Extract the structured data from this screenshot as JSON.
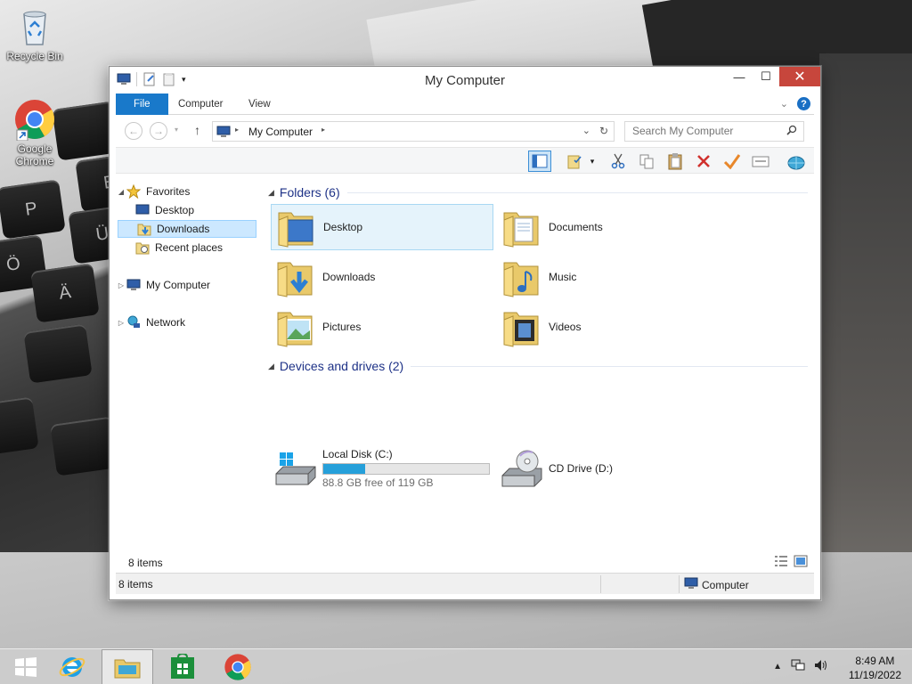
{
  "desktop": {
    "icons": [
      {
        "label": "Recycle Bin"
      },
      {
        "label": "Google Chrome"
      }
    ]
  },
  "window": {
    "title": "My Computer",
    "ribbon_tabs": [
      "File",
      "Computer",
      "View"
    ],
    "address": {
      "path_label": "My Computer"
    },
    "search": {
      "placeholder": "Search My Computer"
    }
  },
  "navpane": {
    "favorites": "Favorites",
    "desktop": "Desktop",
    "downloads": "Downloads",
    "recent": "Recent places",
    "mycomputer": "My Computer",
    "network": "Network"
  },
  "content": {
    "folders_header": "Folders (6)",
    "folders": [
      {
        "label": "Desktop",
        "icon": "desktop-folder-icon"
      },
      {
        "label": "Documents",
        "icon": "documents-folder-icon"
      },
      {
        "label": "Downloads",
        "icon": "downloads-folder-icon"
      },
      {
        "label": "Music",
        "icon": "music-folder-icon"
      },
      {
        "label": "Pictures",
        "icon": "pictures-folder-icon"
      },
      {
        "label": "Videos",
        "icon": "videos-folder-icon"
      }
    ],
    "drives_header": "Devices and drives (2)",
    "drives": [
      {
        "label": "Local Disk (C:)",
        "free_text": "88.8 GB free of 119 GB",
        "used_fraction": 0.254
      },
      {
        "label": "CD Drive (D:)"
      }
    ]
  },
  "footer": {
    "count": "8 items"
  },
  "statusbar": {
    "count": "8 items",
    "location": "Computer"
  },
  "taskbar": {
    "apps": [
      "start",
      "internet-explorer",
      "file-explorer",
      "store",
      "chrome"
    ],
    "clock_time": "8:49 AM",
    "clock_date": "11/19/2022"
  },
  "colors": {
    "accent": "#1979ca",
    "close": "#c7463c",
    "drive_fill": "#26a0da",
    "group_title": "#1e3287"
  }
}
